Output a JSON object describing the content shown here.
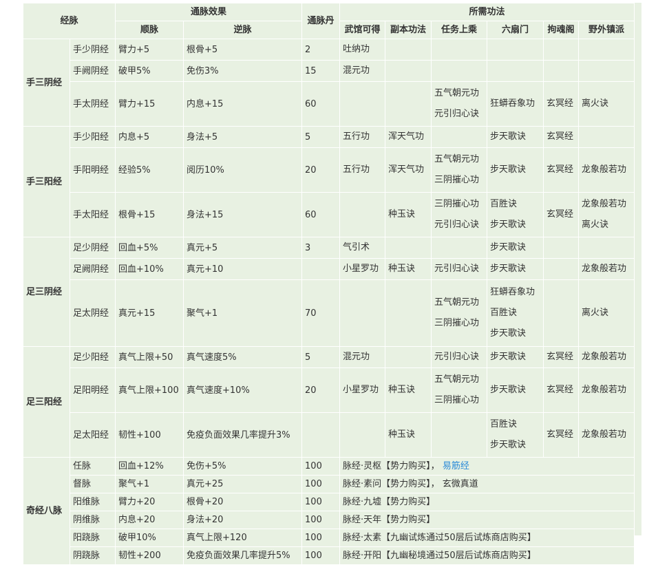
{
  "headers": {
    "meridian": "经脉",
    "effect": "通脉效果",
    "shun": "顺脉",
    "ni": "逆脉",
    "dan": "通脉丹",
    "required": "所需功法",
    "sub": [
      "武馆可得",
      "副本功法",
      "任务上乘",
      "六扇门",
      "拘魂阁",
      "野外镇派"
    ]
  },
  "groups": [
    {
      "name": "手三阴经",
      "rows": [
        {
          "m": "手少阴经",
          "shun": "臂力+5",
          "ni": "根骨+5",
          "dan": "2",
          "c": [
            [
              "吐纳功"
            ],
            [],
            [],
            [],
            [],
            []
          ]
        },
        {
          "m": "手阙阴经",
          "shun": "破甲5%",
          "ni": "免伤3%",
          "dan": "15",
          "c": [
            [
              "混元功"
            ],
            [],
            [],
            [],
            [],
            []
          ]
        },
        {
          "m": "手太阴经",
          "shun": "臂力+15",
          "ni": "内息+15",
          "dan": "60",
          "c": [
            [],
            [],
            [
              "五气朝元功",
              "元引归心诀"
            ],
            [
              "狂蟒吞象功"
            ],
            [
              "玄冥经"
            ],
            [
              "离火诀"
            ]
          ]
        }
      ]
    },
    {
      "name": "手三阳经",
      "rows": [
        {
          "m": "手少阳经",
          "shun": "内息+5",
          "ni": "身法+5",
          "dan": "5",
          "c": [
            [
              "五行功"
            ],
            [
              "浑天气功"
            ],
            [],
            [
              "步天歌诀"
            ],
            [
              "玄冥经"
            ],
            []
          ]
        },
        {
          "m": "手阳明经",
          "shun": "经验5%",
          "ni": "阅历10%",
          "dan": "20",
          "c": [
            [
              "五行功"
            ],
            [
              "浑天气功"
            ],
            [
              "五气朝元功",
              "三阴摧心功"
            ],
            [
              "步天歌诀"
            ],
            [
              "玄冥经"
            ],
            [
              "龙象般若功"
            ]
          ]
        },
        {
          "m": "手太阳经",
          "shun": "根骨+15",
          "ni": "身法+15",
          "dan": "60",
          "c": [
            [],
            [
              "种玉诀"
            ],
            [
              "三阴摧心功",
              "元引归心诀"
            ],
            [
              "百胜诀",
              "步天歌诀"
            ],
            [
              "玄冥经"
            ],
            [
              "龙象般若功",
              "离火诀"
            ]
          ]
        }
      ]
    },
    {
      "name": "足三阴经",
      "rows": [
        {
          "m": "足少阴经",
          "shun": "回血+5%",
          "ni": "真元+5",
          "dan": "3",
          "c": [
            [
              "气引术"
            ],
            [],
            [],
            [
              "步天歌诀"
            ],
            [],
            []
          ]
        },
        {
          "m": "足阙阴经",
          "shun": "回血+10%",
          "ni": "真元+10",
          "dan": "",
          "c": [
            [
              "小星罗功"
            ],
            [
              "种玉诀"
            ],
            [
              "元引归心诀"
            ],
            [
              "步天歌诀"
            ],
            [],
            [
              "龙象般若功"
            ]
          ]
        },
        {
          "m": "足太阴经",
          "shun": "真元+15",
          "ni": "聚气+1",
          "dan": "70",
          "c": [
            [],
            [],
            [
              "五气朝元功",
              "三阴摧心功"
            ],
            [
              "狂蟒吞象功",
              "百胜诀",
              "步天歌诀"
            ],
            [],
            [
              "离火诀"
            ]
          ]
        }
      ]
    },
    {
      "name": "足三阳经",
      "rows": [
        {
          "m": "足少阳经",
          "shun": "真气上限+50",
          "ni": "真气速度5%",
          "dan": "5",
          "c": [
            [
              "混元功"
            ],
            [],
            [
              "元引归心诀"
            ],
            [
              "步天歌诀"
            ],
            [
              "玄冥经"
            ],
            [
              "龙象般若功"
            ]
          ]
        },
        {
          "m": "足阳明经",
          "shun": "真气上限+100",
          "ni": "真气速度+10%",
          "dan": "20",
          "c": [
            [
              "小星罗功"
            ],
            [
              "种玉诀"
            ],
            [
              "五气朝元功",
              "三阴摧心功"
            ],
            [
              "步天歌诀"
            ],
            [
              "玄冥经"
            ],
            [
              "龙象般若功"
            ]
          ]
        },
        {
          "m": "足太阳经",
          "shun": "韧性+100",
          "ni": "免疫负面效果几率提升3%",
          "dan": "",
          "c": [
            [],
            [
              "种玉诀"
            ],
            [],
            [
              "百胜诀",
              "步天歌诀"
            ],
            [
              "玄冥经"
            ],
            [
              "龙象般若功"
            ]
          ]
        }
      ]
    }
  ],
  "extra": {
    "name": "奇经八脉",
    "rows": [
      {
        "m": "任脉",
        "shun": "回血+12%",
        "ni": "免伤+5%",
        "dan": "100",
        "text": "脉经·灵枢【势力购买】，",
        "link": "易筋经"
      },
      {
        "m": "督脉",
        "shun": "聚气+1",
        "ni": "真元+25",
        "dan": "100",
        "text": "脉经·素问【势力购买】，  玄微真道",
        "link": ""
      },
      {
        "m": "阳维脉",
        "shun": "臂力+20",
        "ni": "根骨+20",
        "dan": "100",
        "text": "脉经·九墟【势力购买】",
        "link": ""
      },
      {
        "m": "阴维脉",
        "shun": "内息+20",
        "ni": "身法+20",
        "dan": "100",
        "text": "脉经·天年【势力购买】",
        "link": ""
      },
      {
        "m": "阳跷脉",
        "shun": "破甲10%",
        "ni": "真气上限+120",
        "dan": "100",
        "text": "脉经·太素【九幽试炼通过50层后试炼商店购买】",
        "link": ""
      },
      {
        "m": "阴跷脉",
        "shun": "韧性+200",
        "ni": "免疫负面效果几率提升5%",
        "dan": "100",
        "text": "脉经·开阳【九幽秘境通过50层后试炼商店购买】",
        "link": ""
      }
    ]
  },
  "colors": {
    "cell_bg": "#e8f1e2",
    "border": "#ffffff",
    "link": "#2a8ad8"
  }
}
